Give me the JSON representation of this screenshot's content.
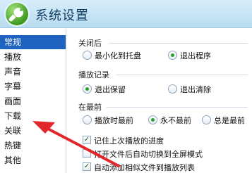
{
  "window": {
    "title": "系统设置",
    "logo_icon": "wrench-icon"
  },
  "sidebar": {
    "items": [
      {
        "label": "常规",
        "active": true
      },
      {
        "label": "播放"
      },
      {
        "label": "声音"
      },
      {
        "label": "字幕"
      },
      {
        "label": "画面"
      },
      {
        "label": "下载"
      },
      {
        "label": "关联"
      },
      {
        "label": "热键"
      },
      {
        "label": "其他"
      }
    ]
  },
  "sections": {
    "close": {
      "title": "关闭后",
      "options": [
        {
          "label": "最小化到托盘",
          "checked": false
        },
        {
          "label": "退出程序",
          "checked": true
        }
      ]
    },
    "history": {
      "title": "播放记录",
      "options": [
        {
          "label": "退出保留",
          "checked": true
        },
        {
          "label": "退出清除",
          "checked": false
        }
      ]
    },
    "ontop": {
      "title": "在最前",
      "options": [
        {
          "label": "播放时最前",
          "checked": false
        },
        {
          "label": "永不最前",
          "checked": true
        },
        {
          "label": "总是最前",
          "checked": false
        }
      ]
    }
  },
  "checkboxes": [
    {
      "label": "记住上次播放的进度",
      "checked": true
    },
    {
      "label": "打开文件后自动切换到全屏模式",
      "checked": false
    },
    {
      "label": "自动添加相似文件到播放列表",
      "checked": true
    }
  ],
  "colors": {
    "accent": "#1f63c1",
    "radio_dot": "#27a12f",
    "arrow": "#e3262b"
  }
}
